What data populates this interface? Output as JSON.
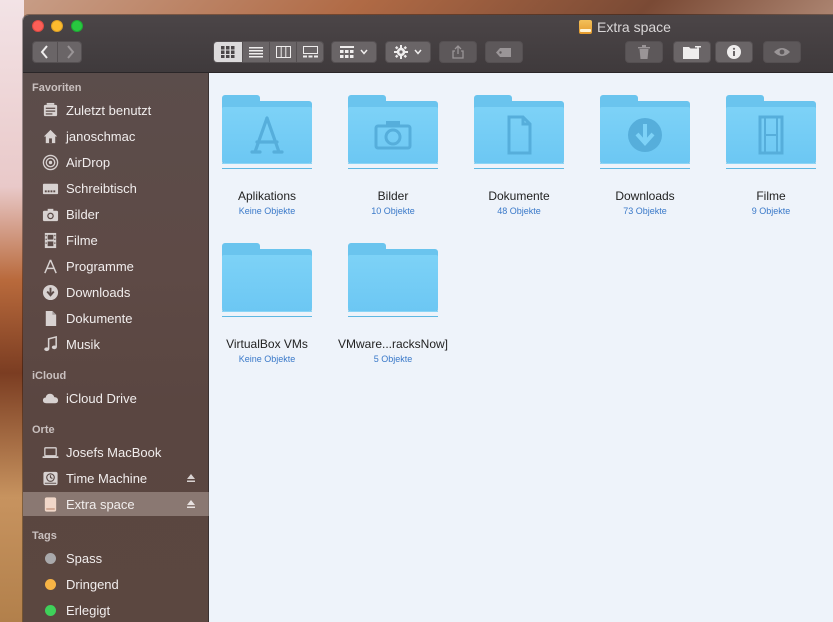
{
  "window": {
    "title": "Extra space"
  },
  "toolbar": {
    "back_label": "‹",
    "forward_label": "›"
  },
  "sidebar": {
    "sections": {
      "favorites": "Favoriten",
      "icloud": "iCloud",
      "places": "Orte",
      "tags": "Tags"
    },
    "favorites": [
      {
        "label": "Zuletzt benutzt",
        "icon": "recents-icon"
      },
      {
        "label": "janoschmac",
        "icon": "home-icon"
      },
      {
        "label": "AirDrop",
        "icon": "airdrop-icon"
      },
      {
        "label": "Schreibtisch",
        "icon": "desktop-icon"
      },
      {
        "label": "Bilder",
        "icon": "camera-icon"
      },
      {
        "label": "Filme",
        "icon": "film-icon"
      },
      {
        "label": "Programme",
        "icon": "applications-icon"
      },
      {
        "label": "Downloads",
        "icon": "download-icon"
      },
      {
        "label": "Dokumente",
        "icon": "document-icon"
      },
      {
        "label": "Musik",
        "icon": "music-icon"
      }
    ],
    "icloud": [
      {
        "label": "iCloud Drive",
        "icon": "cloud-icon"
      }
    ],
    "places": [
      {
        "label": "Josefs MacBook",
        "icon": "laptop-icon"
      },
      {
        "label": "Time Machine",
        "icon": "time-machine-icon"
      },
      {
        "label": "Extra space",
        "icon": "external-drive-icon"
      }
    ],
    "tags": [
      {
        "label": "Spass",
        "color": "#a9a9ab"
      },
      {
        "label": "Dringend",
        "color": "#f7b445"
      },
      {
        "label": "Erlegigt",
        "color": "#3fd15a"
      }
    ]
  },
  "content": {
    "items": [
      {
        "name": "Aplikations",
        "count": "Keine Objekte",
        "icon": "applications-icon"
      },
      {
        "name": "Bilder",
        "count": "10 Objekte",
        "icon": "camera-icon"
      },
      {
        "name": "Dokumente",
        "count": "48 Objekte",
        "icon": "document-icon"
      },
      {
        "name": "Downloads",
        "count": "73 Objekte",
        "icon": "download-icon"
      },
      {
        "name": "Filme",
        "count": "9 Objekte",
        "icon": "film-icon"
      },
      {
        "name": "VirtualBox VMs",
        "count": "Keine Objekte",
        "icon": ""
      },
      {
        "name": "VMware...racksNow]",
        "count": "5 Objekte",
        "icon": ""
      }
    ]
  },
  "colors": {
    "folder": "#6ac4ee",
    "count_text": "#3a79c9",
    "sidebar_bg": "#5b4d4b"
  }
}
